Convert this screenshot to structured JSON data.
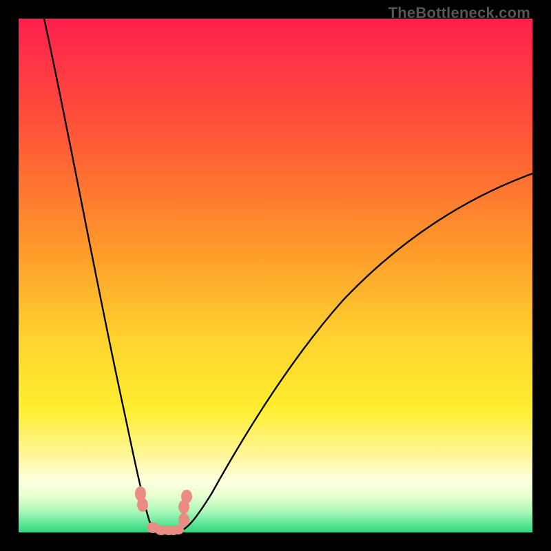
{
  "watermark": "TheBottleneck.com",
  "colors": {
    "top": "#ff1f4e",
    "mid1": "#ff7a2e",
    "mid2": "#ffd22e",
    "yellow": "#ffee2f",
    "palewarm": "#fff8a0",
    "pale": "#f2ffd0",
    "green": "#2bd980",
    "black": "#000000"
  },
  "chart_data": {
    "type": "line",
    "title": "",
    "xlabel": "",
    "ylabel": "",
    "xlim": [
      0,
      100
    ],
    "ylim": [
      0,
      100
    ],
    "note": "Bottleneck-style curve; y≈0 near x≈27–31, rising sharply to left (y→100 at x≈5) and gradually to right (y→70 at x=100). Background is a vertical red→green gradient (green at bottom). No axis ticks or numeric labels are shown.",
    "series": [
      {
        "name": "bottleneck-curve",
        "x": [
          5,
          10,
          15,
          18,
          20,
          22,
          24,
          26,
          27,
          29,
          31,
          33,
          35,
          40,
          45,
          50,
          55,
          60,
          70,
          80,
          90,
          100
        ],
        "y": [
          100,
          80,
          52,
          34,
          22,
          12,
          5,
          1,
          0,
          0,
          0,
          1,
          3,
          10,
          18,
          25,
          32,
          38,
          48,
          56,
          63,
          70
        ]
      }
    ],
    "markers": {
      "name": "salmon-dots",
      "color": "#e98d84",
      "x": [
        23.5,
        24.0,
        26.0,
        27.5,
        29.0,
        30.0,
        31.0,
        32.0,
        32.0,
        32.5
      ],
      "y": [
        7.5,
        5.5,
        1.0,
        0.5,
        0.5,
        0.5,
        0.5,
        2.5,
        5.0,
        7.0
      ]
    }
  }
}
